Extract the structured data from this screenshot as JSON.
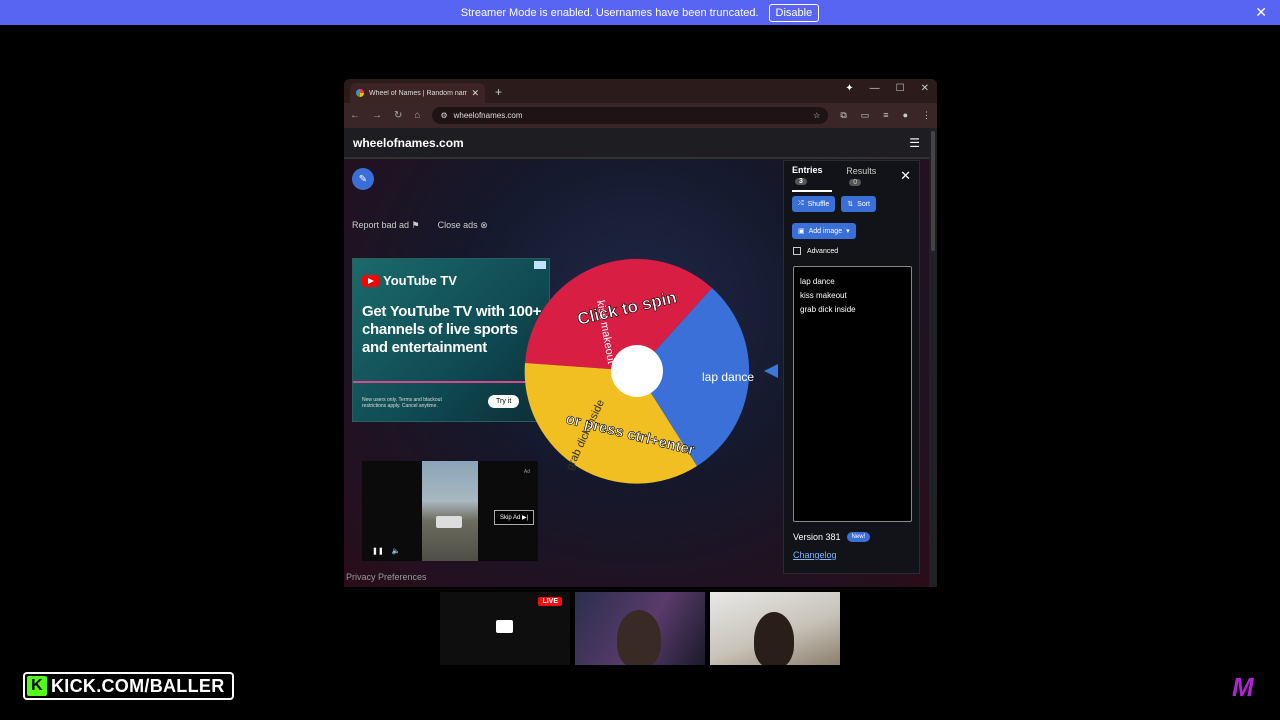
{
  "banner": {
    "text": "Streamer Mode is enabled. Usernames have been truncated.",
    "button": "Disable"
  },
  "browser": {
    "tab_title": "Wheel of Names | Random nam",
    "url": "wheelofnames.com"
  },
  "site": {
    "name": "wheelofnames.com",
    "report_ad": "Report bad ad",
    "close_ads": "Close ads",
    "privacy": "Privacy Preferences"
  },
  "ad": {
    "brand": "YouTube TV",
    "headline": "Get YouTube TV with 100+ channels of live sports and entertainment",
    "fine_print": "New users only. Terms and blackout restrictions apply. Cancel anytime.",
    "cta": "Try it"
  },
  "video_ad": {
    "skip": "Skip Ad ▶|",
    "tag": "Ad"
  },
  "wheel": {
    "segments": [
      {
        "label": "kiss makeout",
        "color": "#d81e43"
      },
      {
        "label": "lap dance",
        "color": "#3a70d8"
      },
      {
        "label": "grab dick inside",
        "color": "#f1bf21"
      }
    ],
    "overlay_top": "Click to spin",
    "overlay_bottom": "or press ctrl+enter"
  },
  "panel": {
    "tab_entries": "Entries",
    "entries_count": "3",
    "tab_results": "Results",
    "results_count": "0",
    "shuffle": "Shuffle",
    "sort": "Sort",
    "add_image": "Add image",
    "advanced": "Advanced",
    "entries": [
      "lap dance",
      "kiss makeout",
      "grab dick inside"
    ],
    "version": "Version 381",
    "new_badge": "New!",
    "changelog": "Changelog"
  },
  "cams": {
    "live": "LIVE"
  },
  "overlay": {
    "kick_url": "KICK.COM/BALLER",
    "corner_logo": "M"
  }
}
